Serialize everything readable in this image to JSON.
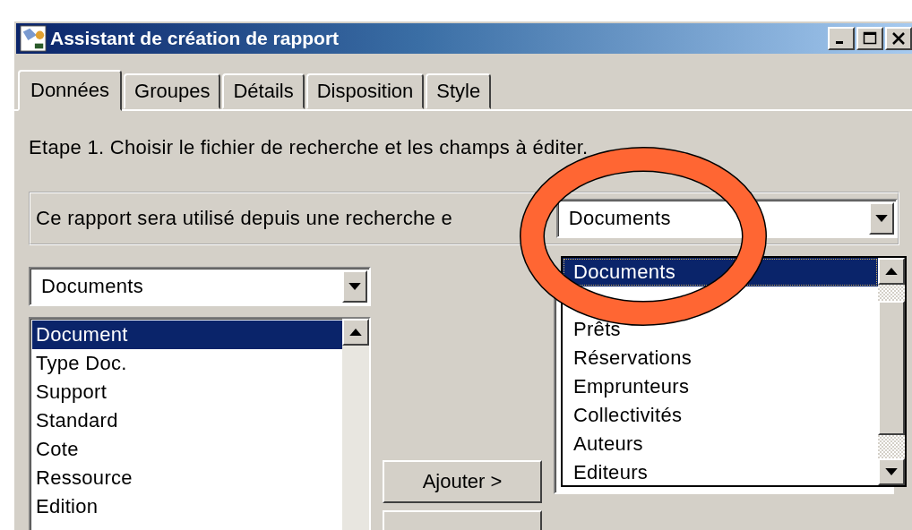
{
  "window": {
    "title": "Assistant de création de rapport"
  },
  "tabs": [
    {
      "label": "Données",
      "selected": true
    },
    {
      "label": "Groupes",
      "selected": false
    },
    {
      "label": "Détails",
      "selected": false
    },
    {
      "label": "Disposition",
      "selected": false
    },
    {
      "label": "Style",
      "selected": false
    }
  ],
  "step_text": "Etape 1. Choisir le fichier de recherche et les champs à éditer.",
  "source_label": "Ce rapport sera utilisé depuis une recherche e",
  "source_combo": {
    "value": "Documents"
  },
  "source_dropdown": {
    "items": [
      {
        "label": "Documents",
        "selected": true
      },
      {
        "label": "Prêts",
        "selected": false
      },
      {
        "label": "Réservations",
        "selected": false
      },
      {
        "label": "Emprunteurs",
        "selected": false
      },
      {
        "label": "Collectivités",
        "selected": false
      },
      {
        "label": "Auteurs",
        "selected": false
      },
      {
        "label": "Editeurs",
        "selected": false
      }
    ]
  },
  "fields_combo": {
    "value": "Documents"
  },
  "fields_list": {
    "items": [
      {
        "label": "Document",
        "selected": true
      },
      {
        "label": "Type Doc.",
        "selected": false
      },
      {
        "label": "Support",
        "selected": false
      },
      {
        "label": "Standard",
        "selected": false
      },
      {
        "label": "Cote",
        "selected": false
      },
      {
        "label": "Ressource",
        "selected": false
      },
      {
        "label": "Edition",
        "selected": false
      }
    ]
  },
  "buttons": [
    {
      "label": "Ajouter >"
    }
  ]
}
